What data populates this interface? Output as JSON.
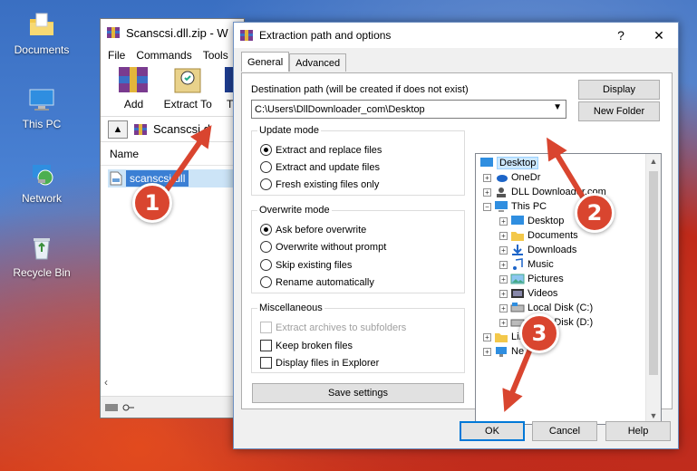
{
  "desktop": {
    "icons": [
      {
        "label": "Documents"
      },
      {
        "label": "This PC"
      },
      {
        "label": "Network"
      },
      {
        "label": "Recycle Bin"
      }
    ]
  },
  "winrar": {
    "title": "Scanscsi.dll.zip - W",
    "menu": [
      "File",
      "Commands",
      "Tools"
    ],
    "toolbar": {
      "add": "Add",
      "extract_to": "Extract To",
      "third": "T"
    },
    "address": "Scanscsi.d",
    "list_header": "Name",
    "file": "scanscsi.dll"
  },
  "dialog": {
    "title": "Extraction path and options",
    "help_glyph": "?",
    "close_glyph": "✕",
    "tabs": [
      "General",
      "Advanced"
    ],
    "dest_label": "Destination path (will be created if does not exist)",
    "dest_value": "C:\\Users\\DllDownloader_com\\Desktop",
    "display_button": "Display",
    "new_folder_button": "New Folder",
    "update_mode": {
      "legend": "Update mode",
      "options": [
        "Extract and replace files",
        "Extract and update files",
        "Fresh existing files only"
      ],
      "selected": 0
    },
    "overwrite_mode": {
      "legend": "Overwrite mode",
      "options": [
        "Ask before overwrite",
        "Overwrite without prompt",
        "Skip existing files",
        "Rename automatically"
      ],
      "selected": 0
    },
    "misc": {
      "legend": "Miscellaneous",
      "options": [
        "Extract archives to subfolders",
        "Keep broken files",
        "Display files in Explorer"
      ]
    },
    "save_settings": "Save settings",
    "tree": [
      "Desktop",
      "OneDr",
      "DLL Downloader.com",
      "This PC",
      "Desktop",
      "Documents",
      "Downloads",
      "Music",
      "Pictures",
      "Videos",
      "Local Disk (C:)",
      "Local Disk (D:)",
      "Libraries",
      "Ne"
    ],
    "ok": "OK",
    "cancel": "Cancel",
    "help": "Help"
  },
  "markers": [
    "1",
    "2",
    "3"
  ],
  "colors": {
    "marker": "#d9452f",
    "selection": "#cce8ff",
    "accent": "#0078d7"
  }
}
